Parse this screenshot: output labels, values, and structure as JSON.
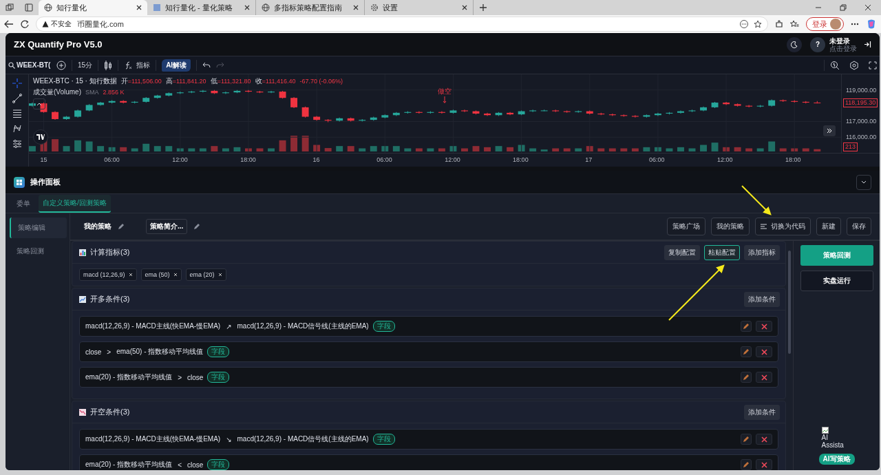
{
  "browser": {
    "tabs": [
      {
        "title": "知行量化",
        "selected": true
      },
      {
        "title": "知行量化 - 量化策略",
        "selected": false
      },
      {
        "title": "多指标策略配置指南",
        "selected": false
      },
      {
        "title": "设置",
        "selected": false
      }
    ],
    "security": "不安全",
    "url": "币圈量化.com",
    "profile_button": "登录"
  },
  "app": {
    "title": "ZX Quantify Pro V5.0",
    "user": {
      "avatar": "?",
      "name": "未登录",
      "hint": "点击登录"
    }
  },
  "toolbar": {
    "symbol": "WEEX-BT(",
    "interval": "15分",
    "indicators": "指标",
    "ai_button": "AI解读"
  },
  "chart": {
    "legend_title": "WEEX-BTC · 15 · 知行数据",
    "ohlc": [
      {
        "label": "开",
        "value": "=111,506.00"
      },
      {
        "label": "高",
        "value": "=111,841.20"
      },
      {
        "label": "低",
        "value": "=111,321.80"
      },
      {
        "label": "收",
        "value": "=111,416.40"
      }
    ],
    "change": "-67.70 (-0.06%)",
    "volume_label": "成交量(Volume)",
    "volume_sma": "SMA",
    "volume_value": "2.856 K",
    "marker": "做空",
    "last_price": "118,195.30",
    "last_volume": "213",
    "chart_data": {
      "type": "candlestick",
      "grid": true,
      "ylim": [
        115000,
        120000
      ],
      "yticks": [
        {
          "value": 119000,
          "label": "119,000.00"
        },
        {
          "value": 117000,
          "label": "117,000.00"
        },
        {
          "value": 116000,
          "label": "116,000.00"
        }
      ],
      "categories": [
        null,
        "15",
        null,
        null,
        null,
        null,
        null,
        "06:00",
        null,
        null,
        null,
        null,
        null,
        "12:00",
        null,
        null,
        null,
        null,
        null,
        "18:00",
        null,
        null,
        null,
        null,
        null,
        "16",
        null,
        null,
        null,
        null,
        null,
        "06:00",
        null,
        null,
        null,
        null,
        null,
        "12:00",
        null,
        null,
        null,
        null,
        null,
        "18:00",
        null,
        null,
        null,
        null,
        null,
        "17",
        null,
        null,
        null,
        null,
        null,
        "06:00",
        null,
        null,
        null,
        null,
        null,
        "12:00",
        null,
        null,
        null,
        null,
        null,
        "18:00",
        null,
        null
      ],
      "ohlc": [
        [
          118000,
          118200,
          117950,
          118150
        ],
        [
          118150,
          118200,
          117550,
          117600
        ],
        [
          117600,
          117650,
          117100,
          117150
        ],
        [
          117150,
          117350,
          117100,
          117300
        ],
        [
          117300,
          117750,
          117250,
          117700
        ],
        [
          117700,
          118100,
          117650,
          118050
        ],
        [
          118050,
          118250,
          118000,
          118200
        ],
        [
          118200,
          118350,
          118150,
          118300
        ],
        [
          118300,
          118350,
          118150,
          118200
        ],
        [
          118200,
          118300,
          118150,
          118250
        ],
        [
          118250,
          118550,
          118200,
          118500
        ],
        [
          118500,
          118700,
          118450,
          118650
        ],
        [
          118650,
          118850,
          118600,
          118800
        ],
        [
          118800,
          118900,
          118750,
          118850
        ],
        [
          118850,
          118950,
          118800,
          118900
        ],
        [
          118900,
          119000,
          118850,
          118950
        ],
        [
          118950,
          119000,
          118750,
          118800
        ],
        [
          118800,
          118900,
          118750,
          118850
        ],
        [
          118850,
          119000,
          118800,
          118950
        ],
        [
          118950,
          119000,
          118850,
          118900
        ],
        [
          118900,
          118950,
          118800,
          118850
        ],
        [
          118850,
          118950,
          118800,
          118900
        ],
        [
          118900,
          118950,
          118450,
          118500
        ],
        [
          118500,
          118550,
          117850,
          117900
        ],
        [
          117900,
          117950,
          117250,
          117300
        ],
        [
          117300,
          117350,
          117050,
          117100
        ],
        [
          117100,
          117150,
          116950,
          117050
        ],
        [
          117050,
          117250,
          117000,
          117200
        ],
        [
          117200,
          117250,
          117000,
          117050
        ],
        [
          117050,
          117150,
          117000,
          117100
        ],
        [
          117100,
          117300,
          117050,
          117250
        ],
        [
          117250,
          117450,
          117200,
          117400
        ],
        [
          117400,
          117600,
          117350,
          117550
        ],
        [
          117550,
          117650,
          117500,
          117600
        ],
        [
          117600,
          117650,
          117500,
          117550
        ],
        [
          117550,
          117650,
          117500,
          117600
        ],
        [
          117600,
          117650,
          117500,
          117550
        ],
        [
          117550,
          117750,
          117500,
          117700
        ],
        [
          117700,
          117750,
          117600,
          117650
        ],
        [
          117650,
          117700,
          117450,
          117500
        ],
        [
          117500,
          117550,
          117350,
          117400
        ],
        [
          117400,
          117600,
          117350,
          117550
        ],
        [
          117550,
          117600,
          117400,
          117450
        ],
        [
          117450,
          117700,
          117400,
          117650
        ],
        [
          117650,
          117750,
          117600,
          117700
        ],
        [
          117700,
          117750,
          117650,
          117700
        ],
        [
          117700,
          117750,
          117600,
          117650
        ],
        [
          117650,
          117700,
          117550,
          117600
        ],
        [
          117600,
          117700,
          117550,
          117650
        ],
        [
          117650,
          117700,
          117450,
          117500
        ],
        [
          117500,
          117550,
          117400,
          117450
        ],
        [
          117450,
          117500,
          117350,
          117400
        ],
        [
          117400,
          117450,
          117300,
          117350
        ],
        [
          117350,
          117400,
          117250,
          117300
        ],
        [
          117300,
          117450,
          117250,
          117400
        ],
        [
          117400,
          117550,
          117350,
          117500
        ],
        [
          117500,
          117600,
          117450,
          117550
        ],
        [
          117550,
          117700,
          117500,
          117650
        ],
        [
          117650,
          117750,
          117600,
          117700
        ],
        [
          117700,
          117950,
          117650,
          117900
        ],
        [
          117900,
          118250,
          117850,
          118200
        ],
        [
          118200,
          118250,
          118050,
          118100
        ],
        [
          118100,
          118150,
          117950,
          118000
        ],
        [
          118000,
          118050,
          117900,
          117950
        ],
        [
          117950,
          118050,
          117900,
          118000
        ],
        [
          118000,
          118400,
          117950,
          118350
        ],
        [
          118350,
          118400,
          118250,
          118300
        ],
        [
          118300,
          118350,
          118200,
          118250
        ],
        [
          118250,
          118300,
          118150,
          118200
        ],
        [
          118200,
          118300,
          118150,
          118195.3
        ]
      ]
    }
  },
  "panel": {
    "title": "操作面板",
    "tabs": [
      {
        "label": "委单",
        "selected": false
      },
      {
        "label": "自定义策略/回测策略",
        "selected": true
      }
    ],
    "nav": [
      {
        "label": "策略编辑",
        "selected": true
      },
      {
        "label": "策略回测",
        "selected": false
      }
    ],
    "strategy_name": "我的策略",
    "strategy_intro": "策略简介...",
    "actions": [
      {
        "label": "策略广场",
        "kind": "plain"
      },
      {
        "label": "我的策略",
        "kind": "plain"
      },
      {
        "label": "切换为代码",
        "kind": "code"
      },
      {
        "label": "新建",
        "kind": "plain"
      },
      {
        "label": "保存",
        "kind": "plain"
      }
    ],
    "indicators": {
      "title": "计算指标(3)",
      "buttons": [
        {
          "label": "复制配置",
          "highlighted": false
        },
        {
          "label": "粘贴配置",
          "highlighted": true
        },
        {
          "label": "添加指标",
          "highlighted": false
        }
      ],
      "tags": [
        "macd (12,26,9)",
        "ema (50)",
        "ema (20)"
      ]
    },
    "condition_groups": [
      {
        "title": "开多条件(3)",
        "kind": "long",
        "button": "添加条件",
        "conditions": [
          {
            "left": "macd(12,26,9) - MACD主线(快EMA-慢EMA)",
            "operator": "↗",
            "right": "macd(12,26,9) - MACD信号线(主线的EMA)",
            "badge": "字段"
          },
          {
            "left": "close",
            "operator": ">",
            "right": "ema(50) - 指数移动平均线值",
            "badge": "字段"
          },
          {
            "left": "ema(20) - 指数移动平均线值",
            "operator": ">",
            "right": "close",
            "badge": "字段"
          }
        ]
      },
      {
        "title": "开空条件(3)",
        "kind": "short",
        "button": "添加条件",
        "conditions": [
          {
            "left": "macd(12,26,9) - MACD主线(快EMA-慢EMA)",
            "operator": "↘",
            "right": "macd(12,26,9) - MACD信号线(主线的EMA)",
            "badge": "字段"
          },
          {
            "left": "ema(20) - 指数移动平均线值",
            "operator": "<",
            "right": "close",
            "badge": "字段"
          }
        ]
      }
    ],
    "side": {
      "primary": "策略回测",
      "secondary": "实盘运行",
      "image_alt": "AI Assista",
      "ai_badge": "AI写策略"
    }
  }
}
